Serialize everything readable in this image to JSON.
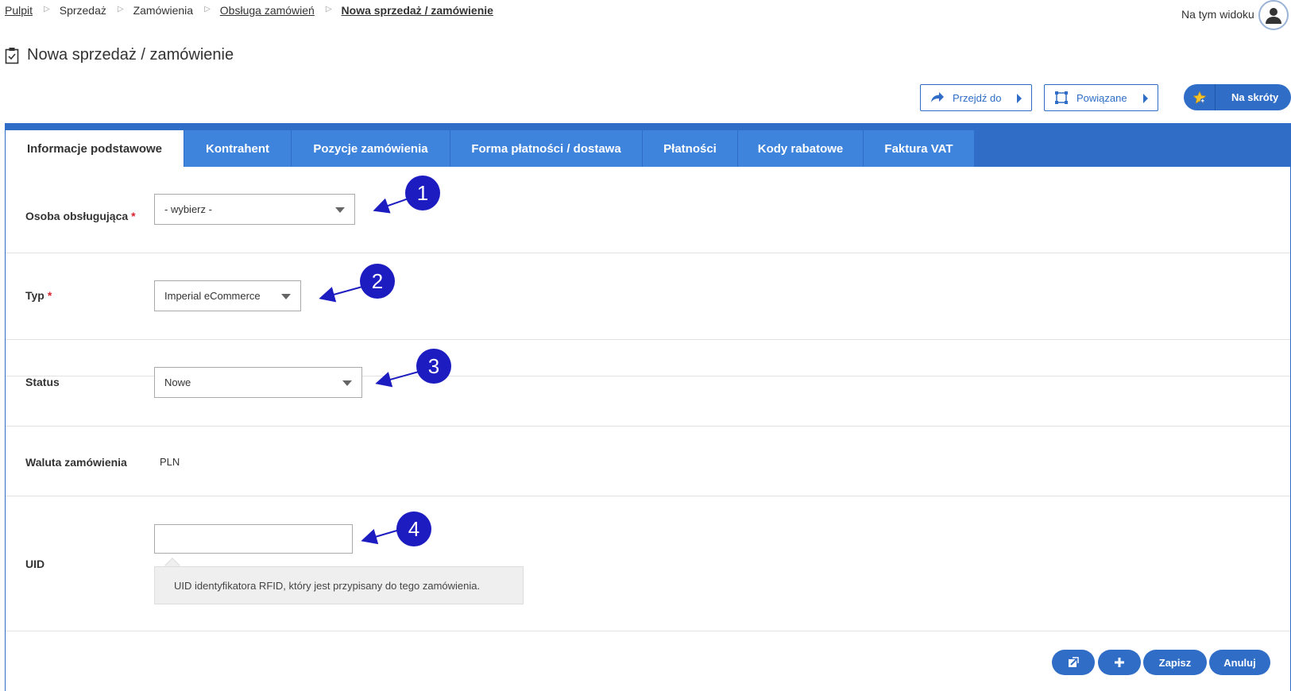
{
  "breadcrumb": {
    "items": [
      "Pulpit",
      "Sprzedaż",
      "Zamówienia",
      "Obsługa zamówień",
      "Nowa sprzedaż / zamówienie"
    ]
  },
  "header": {
    "view_label": "Na tym widoku",
    "title": "Nowa sprzedaż / zamówienie"
  },
  "toolbar": {
    "goto_label": "Przejdź do",
    "related_label": "Powiązane",
    "shortcuts_label": "Na skróty"
  },
  "tabs": [
    {
      "label": "Informacje podstawowe",
      "active": true
    },
    {
      "label": "Kontrahent"
    },
    {
      "label": "Pozycje zamówienia"
    },
    {
      "label": "Forma płatności / dostawa"
    },
    {
      "label": "Płatności"
    },
    {
      "label": "Kody rabatowe"
    },
    {
      "label": "Faktura VAT"
    }
  ],
  "form": {
    "handler": {
      "label": "Osoba obsługująca",
      "required_mark": "*",
      "value": "- wybierz -"
    },
    "type": {
      "label": "Typ",
      "required_mark": "*",
      "value": "Imperial eCommerce"
    },
    "status": {
      "label": "Status",
      "value": "Nowe"
    },
    "currency": {
      "label": "Waluta zamówienia",
      "value": "PLN"
    },
    "uid": {
      "label": "UID",
      "value": "",
      "hint": "UID identyfikatora RFID, który jest przypisany do tego zamówienia."
    }
  },
  "callouts": [
    "1",
    "2",
    "3",
    "4"
  ],
  "actions": {
    "save_label": "Zapisz",
    "cancel_label": "Anuluj"
  },
  "colors": {
    "primary": "#2f6dc6",
    "tab": "#3f84dc",
    "callout": "#1d1cc0",
    "required": "#d9232d"
  }
}
